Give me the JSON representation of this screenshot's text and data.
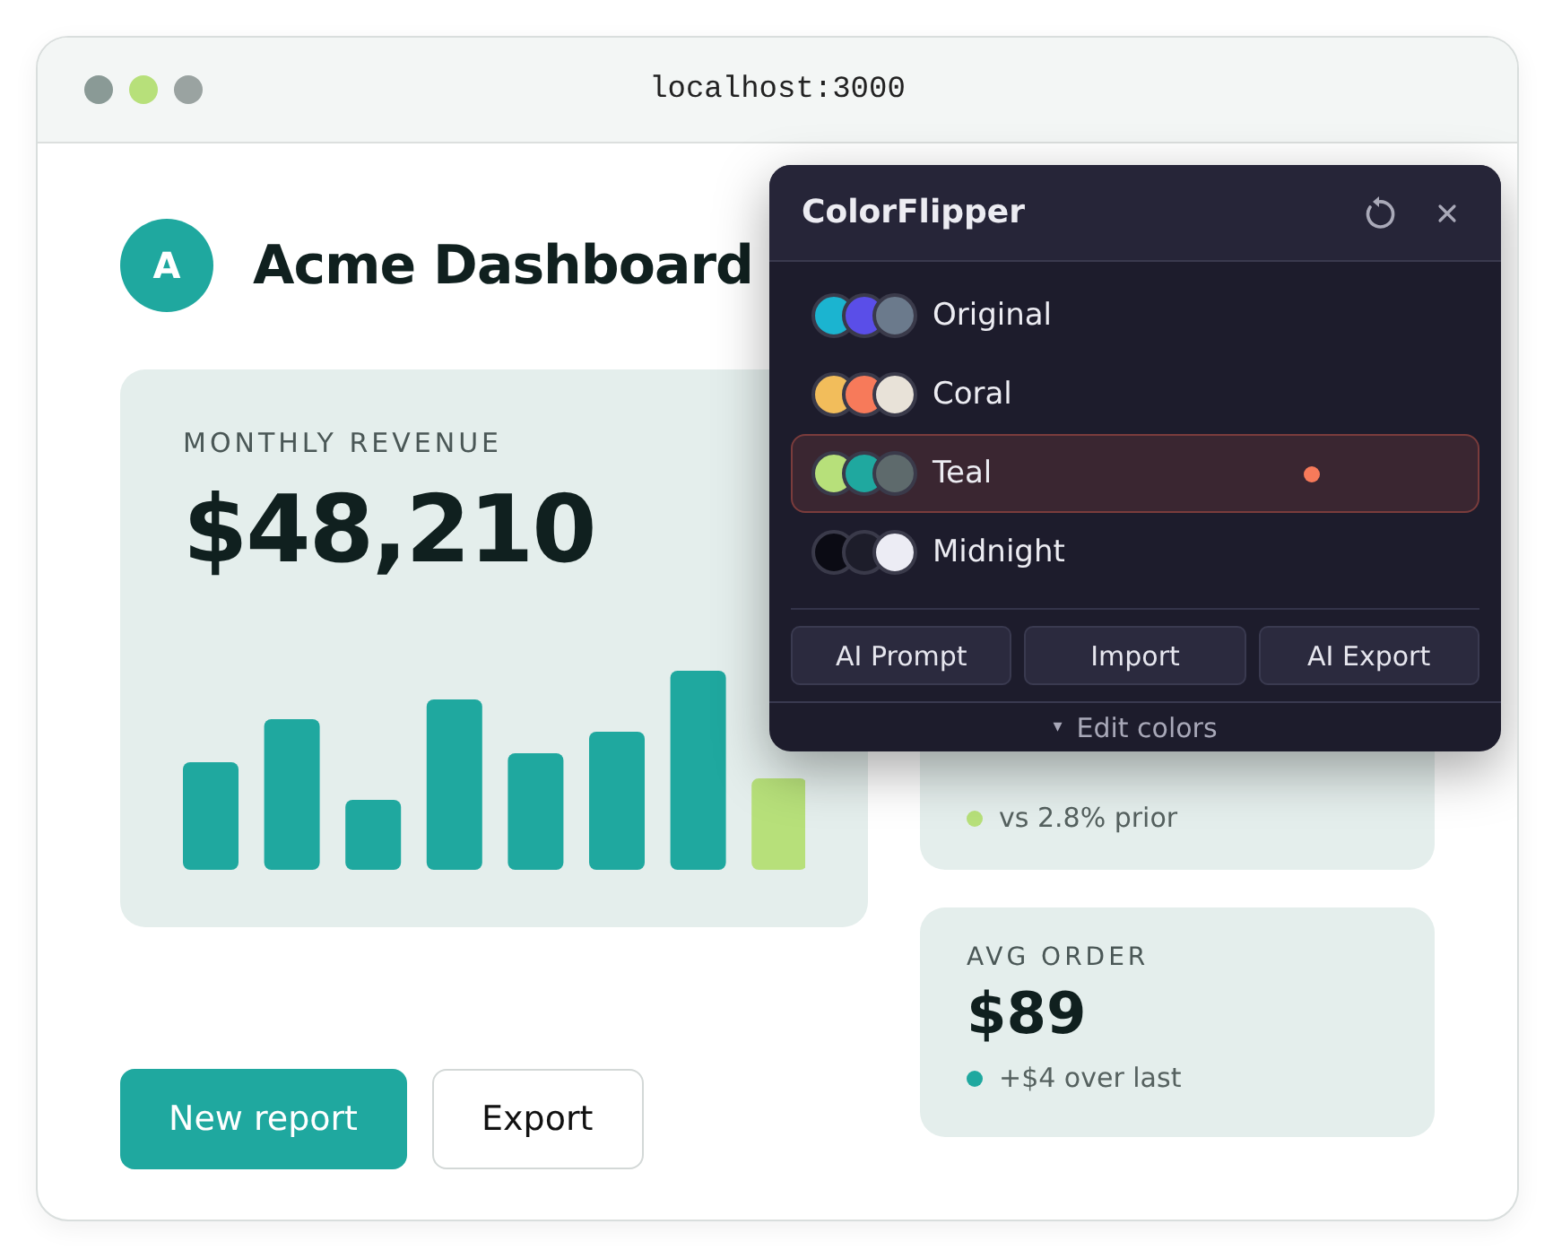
{
  "window": {
    "url": "localhost:3000",
    "controls": [
      {
        "color": "#8a9a96"
      },
      {
        "color": "#b7e07a"
      },
      {
        "color": "#9aa3a1"
      }
    ]
  },
  "header": {
    "avatar": "A",
    "title": "Acme Dashboard"
  },
  "revenue": {
    "label": "MONTHLY REVENUE",
    "value": "$48,210"
  },
  "metrics": [
    {
      "note": "vs 2.8% prior",
      "color": "#b7e07a"
    },
    {
      "label": "AVG ORDER",
      "value": "$89",
      "note": "+$4 over last",
      "color": "#1fa89f"
    }
  ],
  "actions": [
    {
      "label": "New report",
      "kind": "primary"
    },
    {
      "label": "Export",
      "kind": "secondary"
    }
  ],
  "popup": {
    "title": "ColorFlipper",
    "themes": [
      {
        "name": "Original",
        "selected": false,
        "active": false,
        "swatches": [
          {
            "color": "#1bb4d0"
          },
          {
            "color": "#5a4ee8"
          },
          {
            "color": "#6b7a8c"
          }
        ]
      },
      {
        "name": "Coral",
        "selected": false,
        "active": false,
        "swatches": [
          {
            "color": "#f2bd5b"
          },
          {
            "color": "#f77a5a"
          },
          {
            "color": "#e8e2d8"
          }
        ]
      },
      {
        "name": "Teal",
        "selected": true,
        "active": true,
        "swatches": [
          {
            "color": "#b7e07a"
          },
          {
            "color": "#1fa89f"
          },
          {
            "color": "#5e6a6c"
          }
        ]
      },
      {
        "name": "Midnight",
        "selected": false,
        "active": false,
        "swatches": [
          {
            "color": "#0b0b14"
          },
          {
            "color": "#1d1d2a"
          },
          {
            "color": "#ececf4"
          }
        ]
      }
    ],
    "buttons": [
      "AI Prompt",
      "Import",
      "AI Export"
    ],
    "footer_icon": "▾",
    "footer": "Edit colors"
  }
}
